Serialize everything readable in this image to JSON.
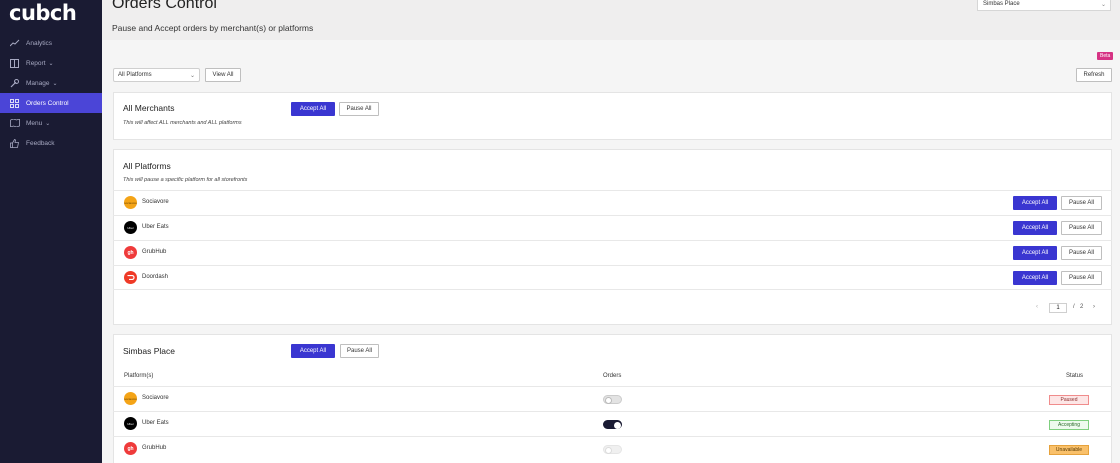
{
  "app": {
    "logo": "cubch"
  },
  "sidebar": {
    "items": [
      {
        "label": "Analytics",
        "icon": "chart-line-icon",
        "chevron": ""
      },
      {
        "label": "Report",
        "icon": "report-icon",
        "chevron": "⌄"
      },
      {
        "label": "Manage",
        "icon": "wrench-icon",
        "chevron": "⌄"
      },
      {
        "label": "Orders Control",
        "icon": "grid-icon",
        "chevron": ""
      },
      {
        "label": "Menu",
        "icon": "map-icon",
        "chevron": "⌄"
      },
      {
        "label": "Feedback",
        "icon": "thumbs-up-icon",
        "chevron": ""
      }
    ]
  },
  "header": {
    "title": "Orders Control",
    "subtitle": "Pause and Accept orders by merchant(s) or platforms",
    "merchant_select": "Simbas Place"
  },
  "toolbar": {
    "platform_filter": "All Platforms",
    "view_all": "View All",
    "beta": "Beta",
    "refresh": "Refresh"
  },
  "all_merchants": {
    "title": "All Merchants",
    "desc": "This will affect ALL merchants and ALL platforms",
    "accept": "Accept All",
    "pause": "Pause All"
  },
  "all_platforms": {
    "title": "All Platforms",
    "desc": "This will pause a specific platform for all storefronts",
    "rows": [
      {
        "name": "Sociavore",
        "accept": "Accept All",
        "pause": "Pause All"
      },
      {
        "name": "Uber Eats",
        "accept": "Accept All",
        "pause": "Pause All"
      },
      {
        "name": "GrubHub",
        "accept": "Accept All",
        "pause": "Pause All"
      },
      {
        "name": "Doordash",
        "accept": "Accept All",
        "pause": "Pause All"
      }
    ],
    "pagination": {
      "current": "1",
      "sep": "/",
      "total": "2"
    }
  },
  "merchant": {
    "title": "Simbas Place",
    "accept": "Accept All",
    "pause": "Pause All",
    "col_platform": "Platform(s)",
    "col_orders": "Orders",
    "col_status": "Status",
    "rows": [
      {
        "name": "Sociavore",
        "status": "Paused"
      },
      {
        "name": "Uber Eats",
        "status": "Accepting"
      },
      {
        "name": "GrubHub",
        "status": "Unavailable"
      }
    ]
  },
  "colors": {
    "sidebar_bg": "#1a1b33",
    "accent": "#3a36d1",
    "sociavore": "#f4a417",
    "ubereats": "#000000",
    "grubhub": "#ef3b3b",
    "doordash": "#ef3a27",
    "paused": "#fde6e6",
    "accepting": "#e8f8e8",
    "unavailable": "#f9c06a"
  }
}
